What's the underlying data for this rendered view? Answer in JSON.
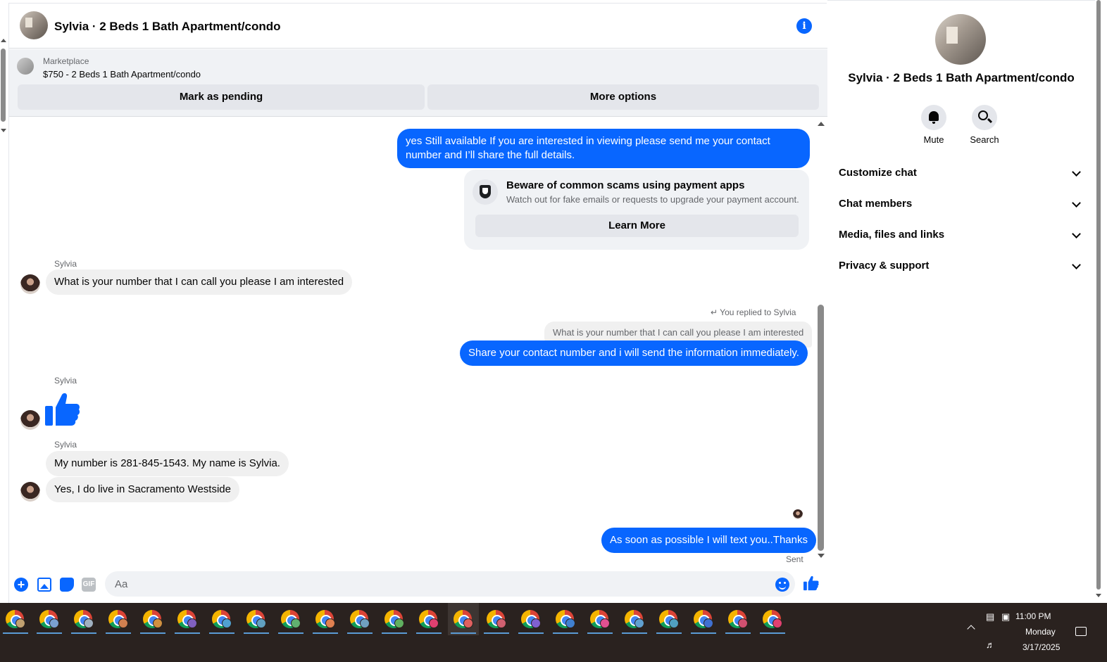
{
  "chat": {
    "title": "Sylvia · 2 Beds 1 Bath Apartment/condo",
    "info_icon": "info-icon"
  },
  "marketplace": {
    "label": "Marketplace",
    "listing": "$750 - 2 Beds 1 Bath Apartment/condo",
    "mark_pending": "Mark as pending",
    "more_options": "More options"
  },
  "messages": {
    "out1": "yes Still available If you are interested in viewing please send me your contact number and I’ll share the full details.",
    "warning_title": "Beware of common scams using payment apps",
    "warning_sub": "Watch out for fake emails or requests to upgrade your payment account.",
    "learn_more": "Learn More",
    "sender1": "Sylvia",
    "in1": "What is your number that I can call you please I am interested",
    "reply_note": "You replied to Sylvia",
    "reply_quote": "What is your number that I can call you please I am interested",
    "out2": "Share your contact number and i will send the information immediately.",
    "sender2": "Sylvia",
    "sender3": "Sylvia",
    "in2": "My number is 281-845-1543. My name is Sylvia.",
    "in3": "Yes, I do live in Sacramento Westside",
    "out3": "As soon as possible I will text you..Thanks",
    "status": "Sent"
  },
  "composer": {
    "placeholder": "Aa",
    "gif_label": "GIF"
  },
  "side": {
    "title": "Sylvia · 2 Beds 1 Bath Apartment/condo",
    "mute": "Mute",
    "search": "Search",
    "sections": [
      "Customize chat",
      "Chat members",
      "Media, files and links",
      "Privacy & support"
    ]
  },
  "taskbar": {
    "time": "11:00 PM",
    "day": "Monday",
    "date": "3/17/2025",
    "app_badges": [
      "#c0a070",
      "#7aa0d0",
      "#a0b0c0",
      "#d08050",
      "#d09040",
      "#8060c0",
      "#50a0d0",
      "#60a0c0",
      "#60b070",
      "#e08050",
      "#70a0c0",
      "#60b060",
      "#e04070",
      "#e06060",
      "#d06070",
      "#8060d0",
      "#4080d0",
      "#e05090",
      "#60a0d0",
      "#50a0c0",
      "#4070d0",
      "#d05070",
      "#e04070"
    ]
  },
  "colors": {
    "accent": "#0866ff",
    "bubble_in": "#f0f0f0",
    "taskbar": "#2a221f"
  }
}
